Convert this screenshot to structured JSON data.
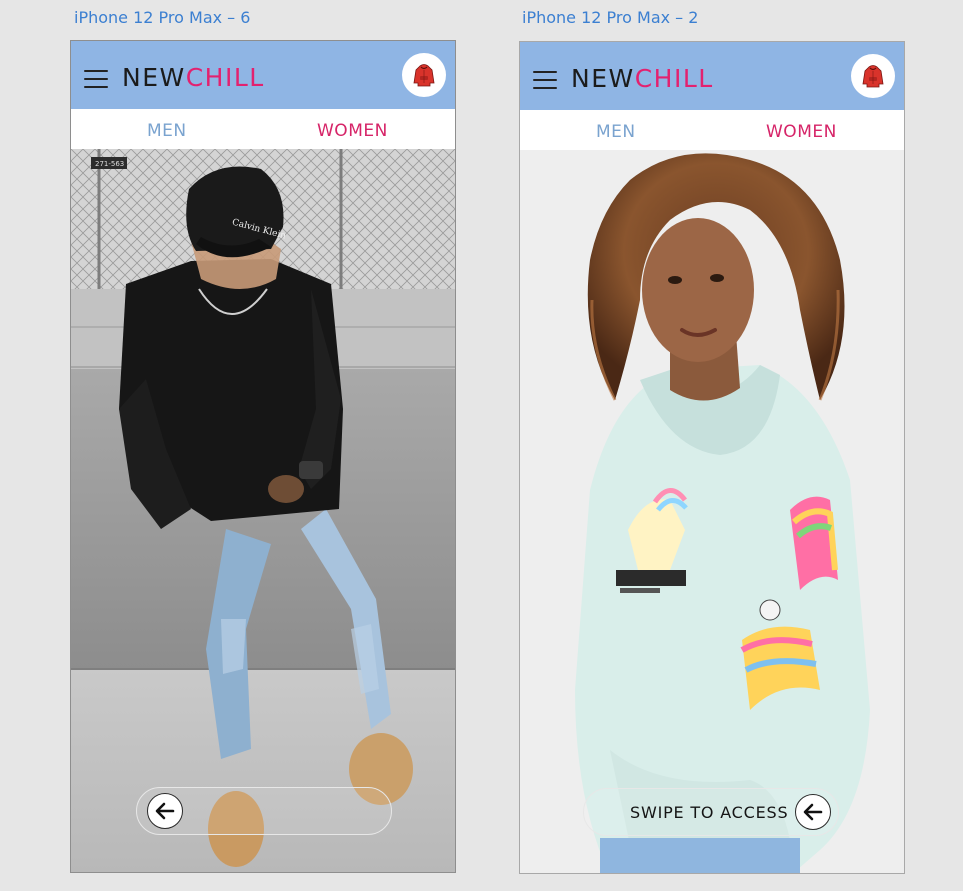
{
  "frames": [
    {
      "label": "iPhone 12 Pro Max – 6",
      "brand": {
        "part1": "NEW",
        "part2": "CHILL"
      },
      "tabs": {
        "men": "MEN",
        "women": "WOMEN"
      },
      "swipe_text": ""
    },
    {
      "label": "iPhone 12 Pro Max – 2",
      "brand": {
        "part1": "NEW",
        "part2": "CHILL"
      },
      "tabs": {
        "men": "MEN",
        "women": "WOMEN"
      },
      "swipe_text": "SWIPE TO ACCESS"
    }
  ],
  "photo_texts": {
    "cap_logo": "Calvin Klein",
    "sign": "271-563"
  },
  "icons": {
    "menu": "hamburger-icon",
    "cart": "hoodie-icon",
    "back": "arrow-left-icon"
  },
  "colors": {
    "appbar": "#8fb5e4",
    "brand_dark": "#1b1b1b",
    "brand_accent": "#e3216f",
    "tab_men": "#7aa3cf",
    "tab_women": "#d62468",
    "label": "#3b7fd1"
  }
}
